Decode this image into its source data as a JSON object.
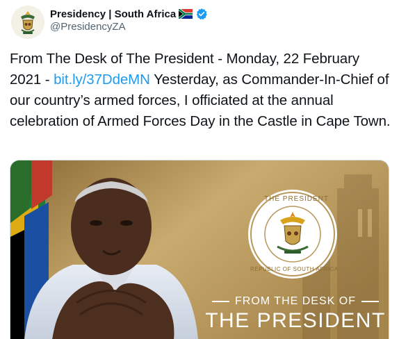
{
  "account": {
    "display_name": "Presidency | South Africa",
    "handle": "@PresidencyZA",
    "icons": [
      "coat-of-arms-avatar",
      "south-africa-flag-icon",
      "verified-badge-icon"
    ]
  },
  "tweet": {
    "text_before_link": "From The Desk of The President - Monday, 22 February 2021 - ",
    "link_text": "bit.ly/37DdeMN",
    "text_after_link": " Yesterday, as Commander-In-Chief of our country’s armed forces, I officiated at the annual celebration of Armed Forces Day in the Castle in Cape Town."
  },
  "media": {
    "seal_top_text": "THE PRESIDENT",
    "seal_bottom_text": "REPUBLIC OF SOUTH AFRICA",
    "banner_line1": "FROM THE DESK OF",
    "banner_line2": "THE PRESIDENT"
  },
  "colors": {
    "link": "#1d9bf0",
    "verified": "#1d9bf0",
    "banner_gold": "#b8975a",
    "handle_gray": "#536471"
  }
}
